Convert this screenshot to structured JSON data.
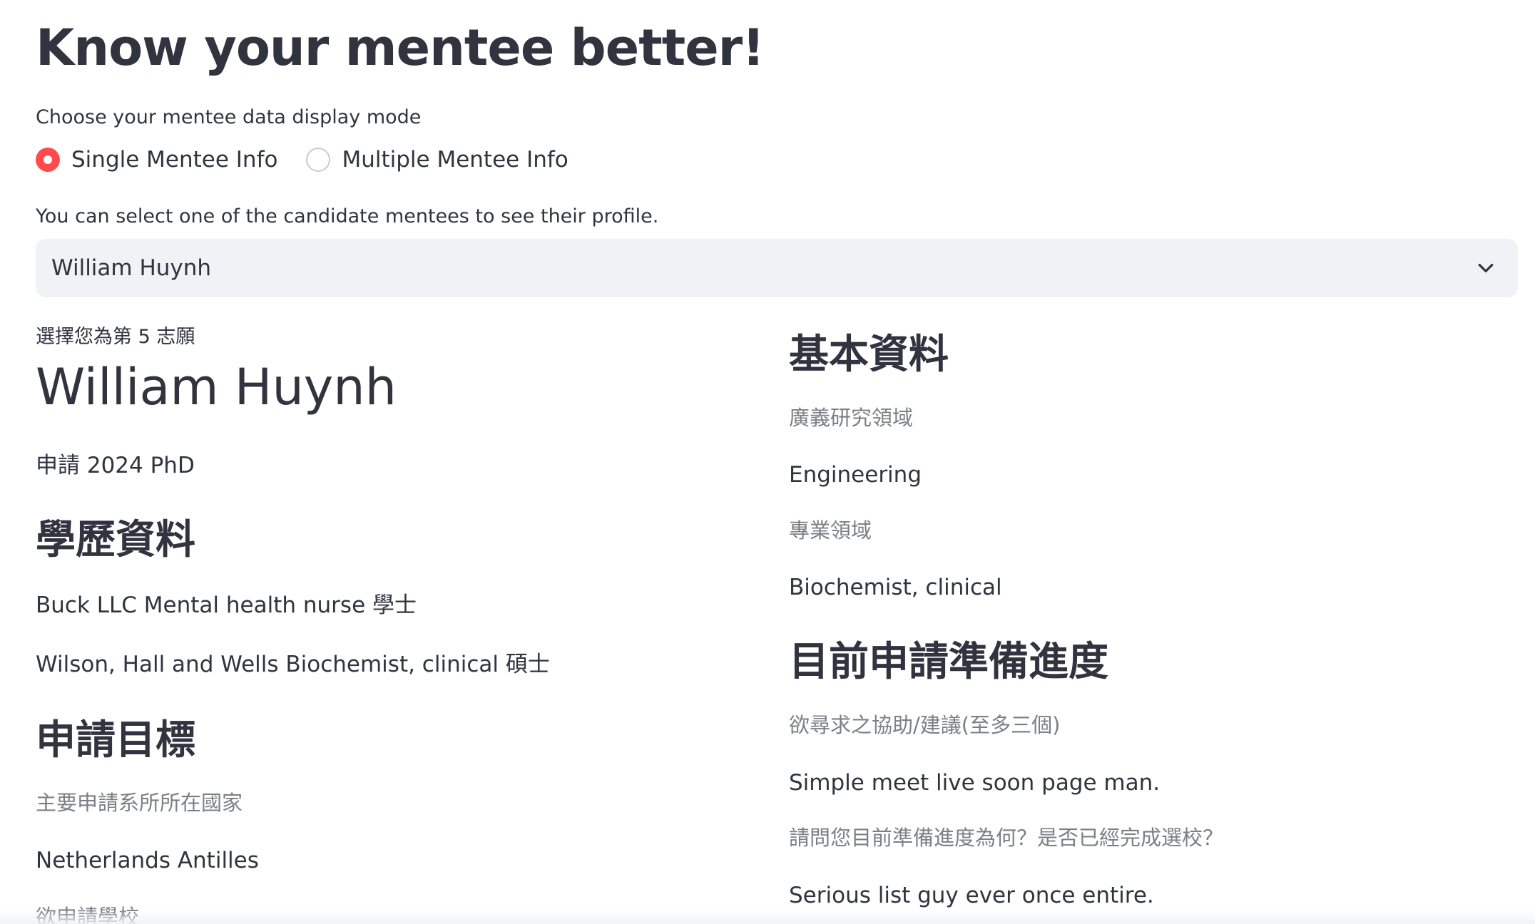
{
  "header": {
    "title": "Know your mentee better!"
  },
  "display_mode": {
    "label": "Choose your mentee data display mode",
    "options": [
      {
        "label": "Single Mentee Info",
        "selected": true
      },
      {
        "label": "Multiple Mentee Info",
        "selected": false
      }
    ]
  },
  "mentee_select": {
    "label": "You can select one of the candidate mentees to see their profile.",
    "value": "William Huynh"
  },
  "profile": {
    "preference_rank": "選擇您為第 5 志願",
    "name": "William Huynh",
    "applying": "申請 2024 PhD",
    "education_heading": "學歷資料",
    "education": [
      "Buck LLC Mental health nurse 學士",
      "Wilson, Hall and Wells Biochemist, clinical 碩士"
    ],
    "goal_heading": "申請目標",
    "target_country_label": "主要申請系所所在國家",
    "target_country": "Netherlands Antilles",
    "target_school_label": "欲申請學校"
  },
  "basic_info": {
    "heading": "基本資料",
    "broad_field_label": "廣義研究領域",
    "broad_field": "Engineering",
    "specialty_label": "專業領域",
    "specialty": "Biochemist, clinical"
  },
  "progress": {
    "heading": "目前申請準備進度",
    "help_label": "欲尋求之協助/建議(至多三個)",
    "help_answer": "Simple meet live soon page man.",
    "status_label": "請問您目前準備進度為何？是否已經完成選校？",
    "status_answer": "Serious list guy ever once entire."
  },
  "colors": {
    "text": "#31333f",
    "muted": "#7d7f87",
    "accent": "#ff4b4b",
    "select_bg": "#f0f2f6"
  }
}
